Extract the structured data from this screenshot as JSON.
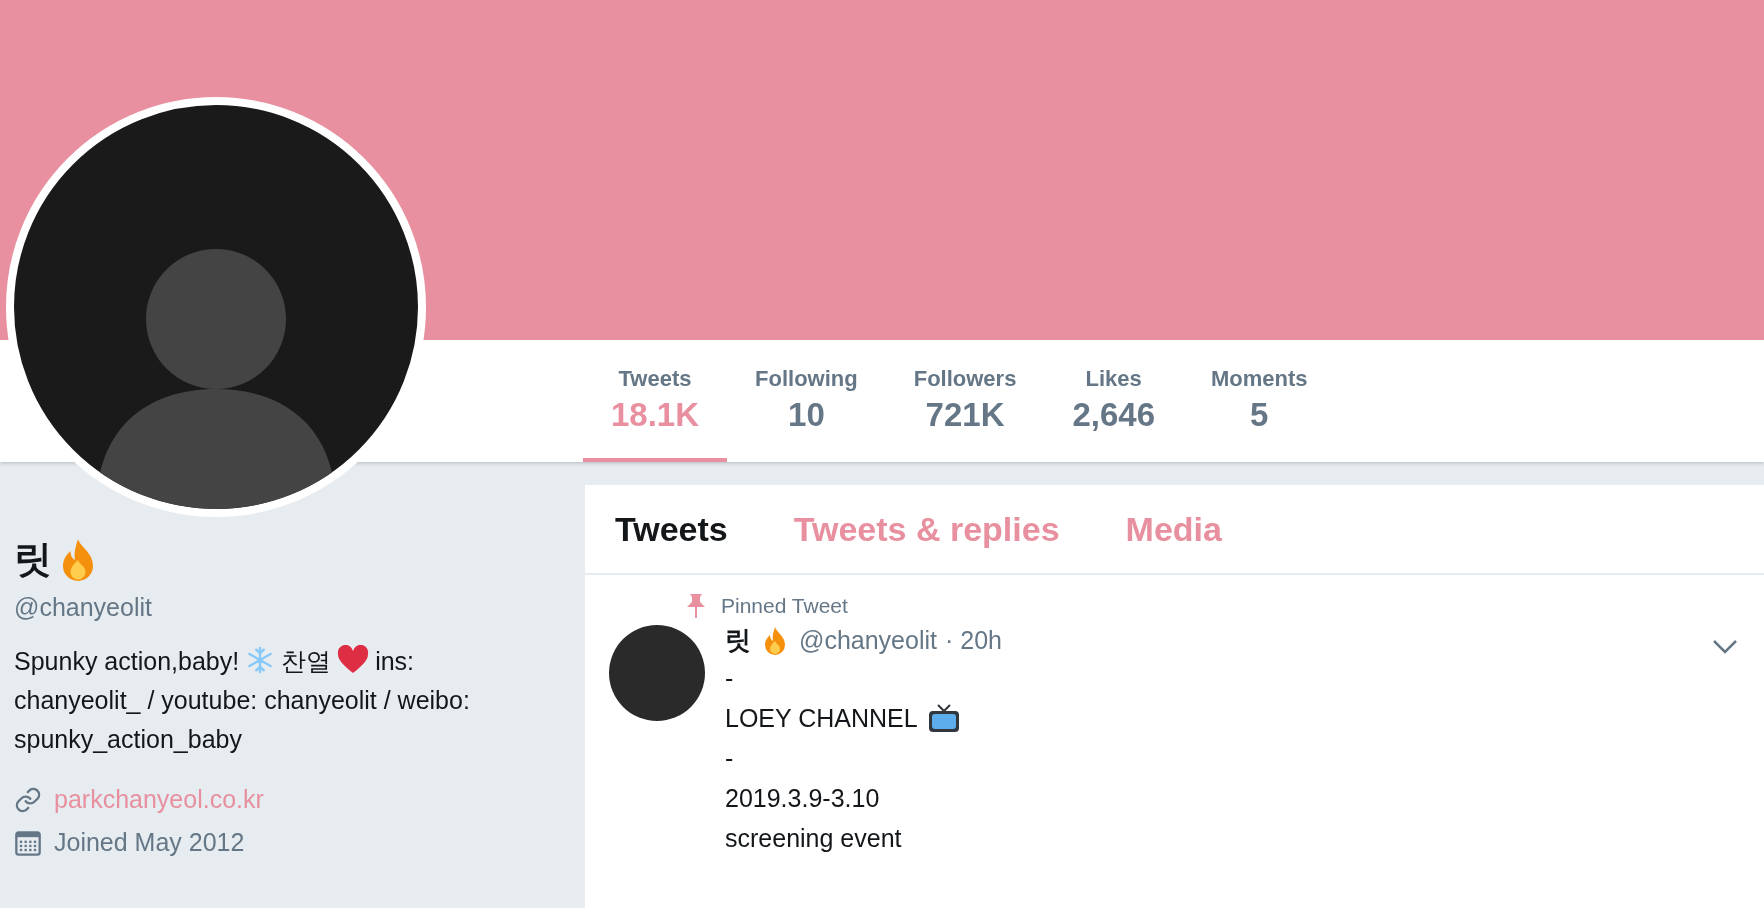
{
  "profile": {
    "name": "릿",
    "handle": "@chanyeolit",
    "bio": [
      {
        "kind": "text",
        "text": "Spunky action,baby!"
      },
      {
        "kind": "snowflake"
      },
      {
        "kind": "text",
        "text": "찬열"
      },
      {
        "kind": "heart"
      },
      {
        "kind": "text",
        "text": "ins:"
      },
      {
        "kind": "paragraph",
        "text": "chanyeolit_ / youtube: chanyeolit / weibo: spunky_action_baby"
      }
    ],
    "website": "parkchanyeol.co.kr",
    "joined": "Joined May 2012"
  },
  "stats": [
    {
      "label": "Tweets",
      "value": "18.1K",
      "selected": true
    },
    {
      "label": "Following",
      "value": "10",
      "selected": false
    },
    {
      "label": "Followers",
      "value": "721K",
      "selected": false
    },
    {
      "label": "Likes",
      "value": "2,646",
      "selected": false
    },
    {
      "label": "Moments",
      "value": "5",
      "selected": false
    }
  ],
  "tabs": [
    {
      "label": "Tweets",
      "selected": true
    },
    {
      "label": "Tweets & replies",
      "selected": false
    },
    {
      "label": "Media",
      "selected": false
    }
  ],
  "pinned_tweet": {
    "pinned_label": "Pinned Tweet",
    "name": "릿",
    "handle": "@chanyeolit",
    "time": "· 20h",
    "lines": [
      {
        "kind": "plain",
        "text": "-"
      },
      {
        "kind": "tv",
        "text": "LOEY CHANNEL"
      },
      {
        "kind": "plain",
        "text": "-"
      },
      {
        "kind": "plain",
        "text": "2019.3.9-3.10"
      },
      {
        "kind": "plain",
        "text": "screening event"
      }
    ]
  }
}
